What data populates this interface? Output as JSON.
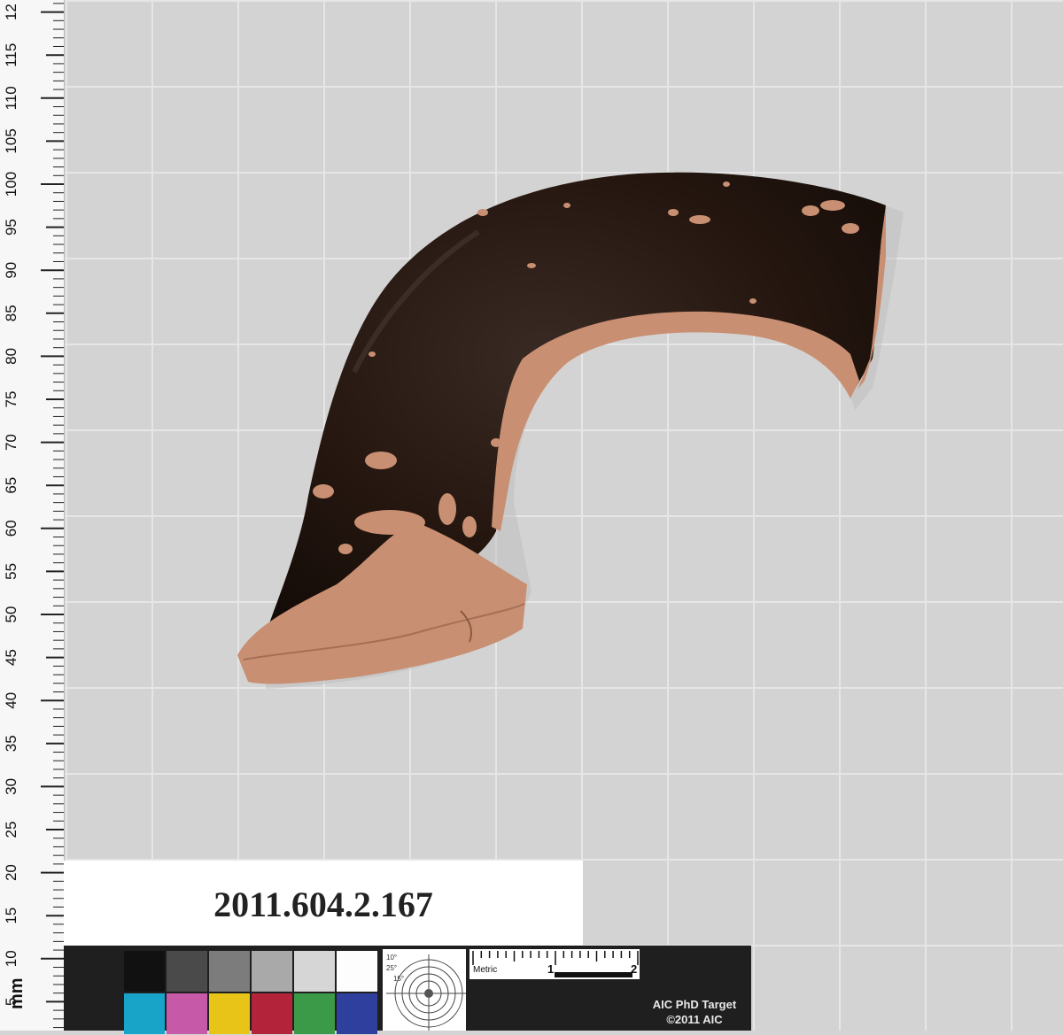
{
  "ruler": {
    "unit": "mm",
    "labels": [
      "5",
      "10",
      "15",
      "20",
      "25",
      "30",
      "35",
      "40",
      "45",
      "50",
      "55",
      "60",
      "65",
      "70",
      "75",
      "80",
      "85",
      "90",
      "95",
      "100",
      "105",
      "110",
      "115",
      "12"
    ]
  },
  "label_card": {
    "catalog_number": "2011.604.2.167"
  },
  "target_card": {
    "scale_label": "Metric",
    "scale_marks": [
      "1",
      "2"
    ],
    "title": "AIC PhD Target",
    "copyright": "©2011 AIC",
    "angle_labels": [
      "10°",
      "25°",
      "15°"
    ],
    "swatch_colors_top": [
      "#111111",
      "#4a4a4a",
      "#7c7c7c",
      "#a9a9a9",
      "#d6d6d6",
      "#fdfdfd"
    ],
    "swatch_colors_bottom": [
      "#18a3c8",
      "#c75aa8",
      "#e8c419",
      "#b3243a",
      "#3b9a48",
      "#2e3f9e"
    ]
  },
  "artifact": {
    "glaze_color": "#2a1a12",
    "clay_color": "#c98f72"
  }
}
